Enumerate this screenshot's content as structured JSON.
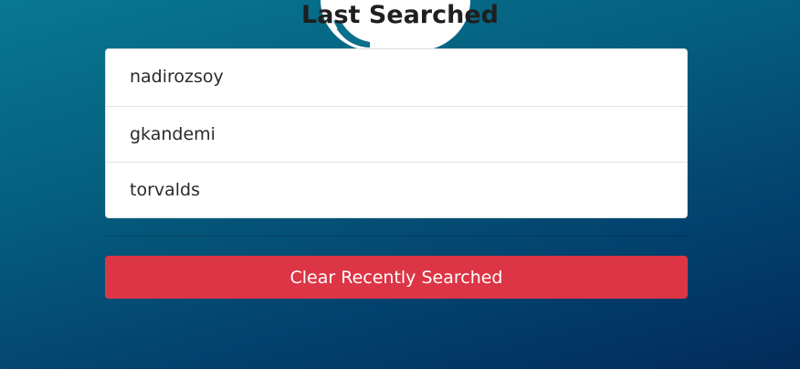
{
  "header": {
    "title": "Last Searched",
    "logo_icon": "github-octocat-icon"
  },
  "recent_searches": [
    {
      "username": "nadirozsoy"
    },
    {
      "username": "gkandemi"
    },
    {
      "username": "torvalds"
    }
  ],
  "actions": {
    "clear_label": "Clear Recently Searched"
  },
  "colors": {
    "danger": "#dc3545",
    "background_start": "#087891",
    "background_end": "#022b5a"
  }
}
